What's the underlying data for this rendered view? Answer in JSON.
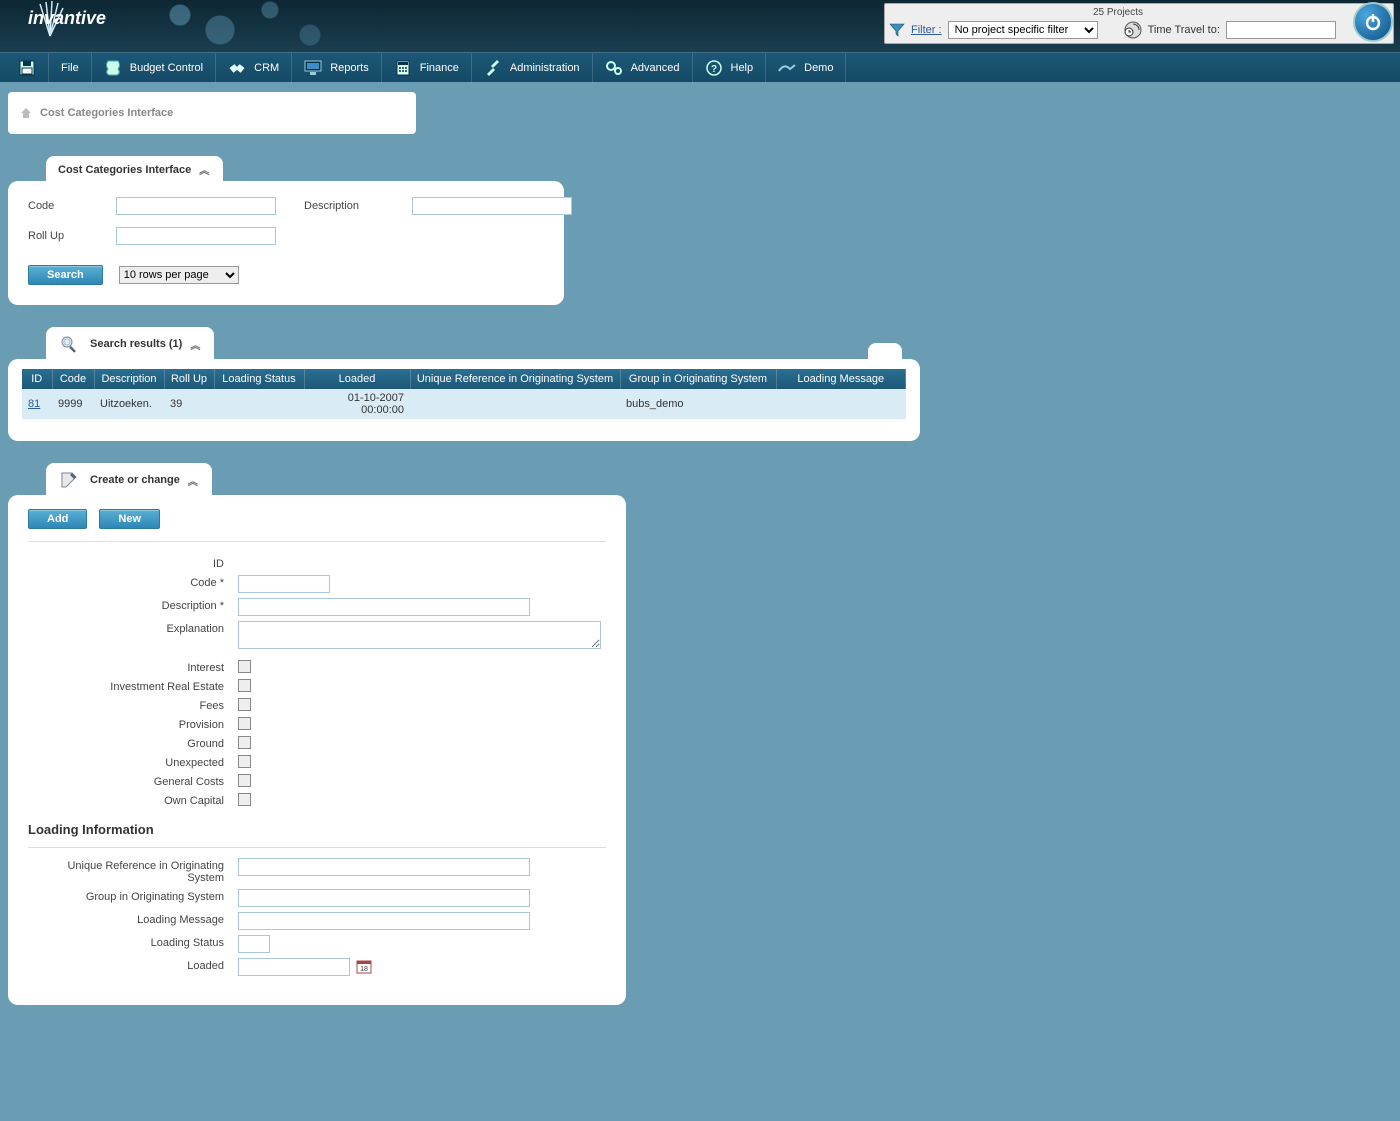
{
  "header": {
    "brand": "invantive",
    "projects_label": "25 Projects",
    "filter_label": "Filter :",
    "filter_selected": "No project specific filter",
    "time_travel_label": "Time Travel to:"
  },
  "menu": {
    "file": "File",
    "budget": "Budget Control",
    "crm": "CRM",
    "reports": "Reports",
    "finance": "Finance",
    "admin": "Administration",
    "advanced": "Advanced",
    "help": "Help",
    "demo": "Demo"
  },
  "breadcrumb": {
    "title": "Cost Categories Interface"
  },
  "search_section": {
    "title": "Cost Categories Interface",
    "labels": {
      "code": "Code",
      "description": "Description",
      "rollup": "Roll Up"
    },
    "search_button": "Search",
    "rows_option": "10 rows per page"
  },
  "results_section": {
    "title": "Search results (1)",
    "headers": {
      "id": "ID",
      "code": "Code",
      "description": "Description",
      "rollup": "Roll Up",
      "loading_status": "Loading Status",
      "loaded": "Loaded",
      "unique_ref": "Unique Reference in Originating System",
      "group": "Group in Originating System",
      "loading_message": "Loading Message"
    },
    "row": {
      "id": "81",
      "code": "9999",
      "description": "Uitzoeken.",
      "rollup": "39",
      "loading_status": "",
      "loaded": "01-10-2007 00:00:00",
      "unique_ref": "",
      "group": "bubs_demo",
      "loading_message": ""
    }
  },
  "form_section": {
    "title": "Create or change",
    "buttons": {
      "add": "Add",
      "new": "New"
    },
    "labels": {
      "id": "ID",
      "code": "Code *",
      "description": "Description *",
      "explanation": "Explanation",
      "interest": "Interest",
      "investment_real_estate": "Investment Real Estate",
      "fees": "Fees",
      "provision": "Provision",
      "ground": "Ground",
      "unexpected": "Unexpected",
      "general_costs": "General Costs",
      "own_capital": "Own Capital"
    },
    "loading_heading": "Loading Information",
    "loading_labels": {
      "unique_ref": "Unique Reference in Originating System",
      "group": "Group in Originating System",
      "loading_message": "Loading Message",
      "loading_status": "Loading Status",
      "loaded": "Loaded"
    }
  }
}
